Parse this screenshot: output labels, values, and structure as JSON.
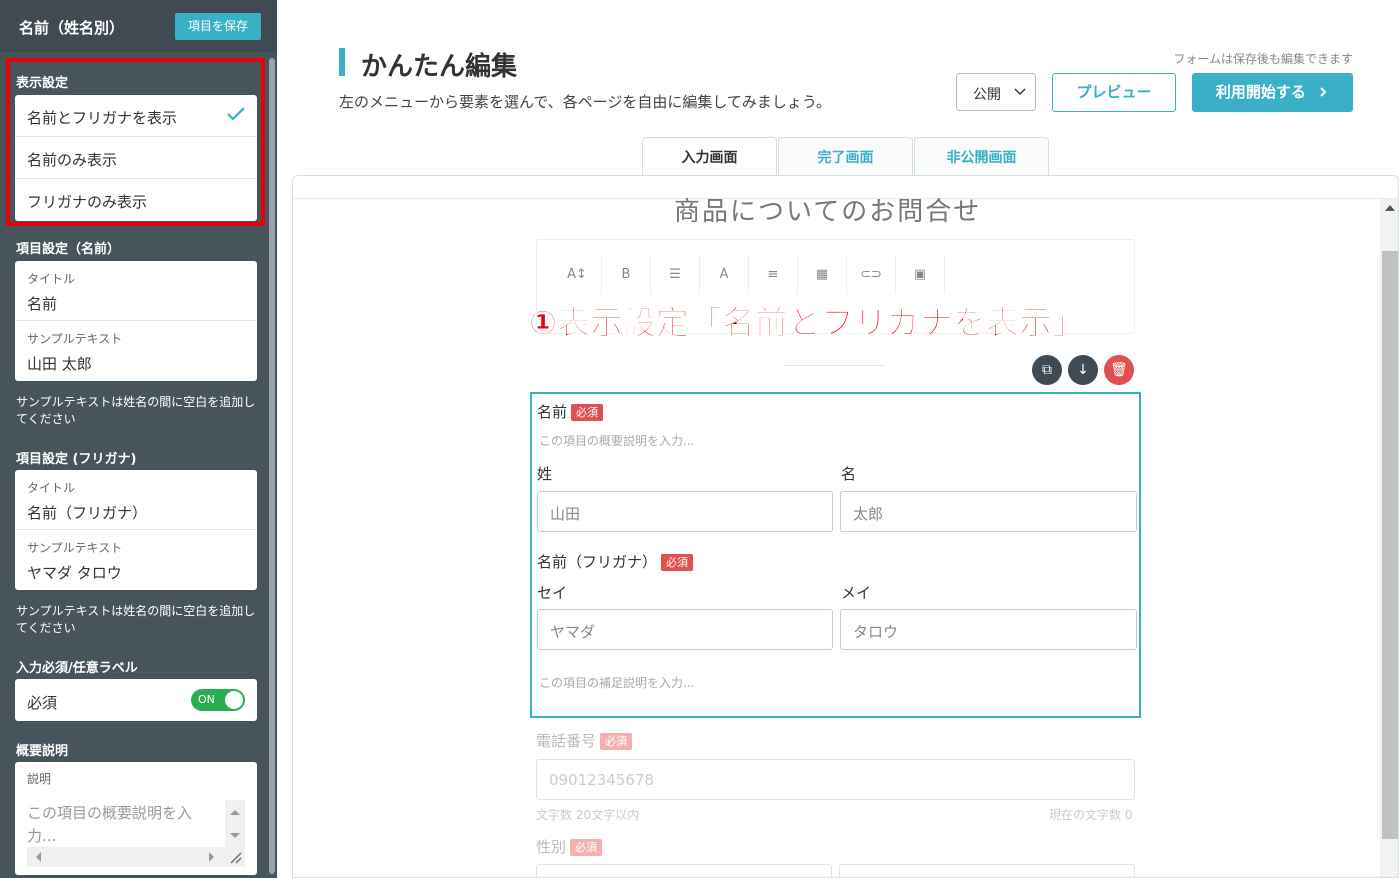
{
  "sidebar": {
    "title": "名前（姓名別）",
    "save_button": "項目を保存",
    "display_settings": {
      "label": "表示設定",
      "options": [
        "名前とフリガナを表示",
        "名前のみ表示",
        "フリガナのみ表示"
      ],
      "selected_index": 0
    },
    "name_settings": {
      "label": "項目設定（名前）",
      "title_label": "タイトル",
      "title_value": "名前",
      "sample_label": "サンプルテキスト",
      "sample_value": "山田 太郎",
      "note": "サンプルテキストは姓名の間に空白を追加してください"
    },
    "kana_settings": {
      "label": "項目設定 (フリガナ)",
      "title_label": "タイトル",
      "title_value": "名前（フリガナ）",
      "sample_label": "サンプルテキスト",
      "sample_value": "ヤマダ タロウ",
      "note": "サンプルテキストは姓名の間に空白を追加してください"
    },
    "required_label": {
      "label": "入力必須/任意ラベル",
      "value": "必須",
      "toggle": "ON",
      "toggle_on": true
    },
    "description": {
      "label": "概要説明",
      "field_label": "説明",
      "placeholder": "この項目の概要説明を入力..."
    }
  },
  "header": {
    "title": "かんたん編集",
    "subtitle": "左のメニューから要素を選んで、各ページを自由に編集してみましょう。",
    "hint": "フォームは保存後も編集できます",
    "public_select": "公開",
    "preview_button": "プレビュー",
    "start_button": "利用開始する"
  },
  "tabs": [
    {
      "label": "入力画面",
      "active": true
    },
    {
      "label": "完了画面",
      "active": false
    },
    {
      "label": "非公開画面",
      "active": false
    }
  ],
  "form": {
    "title": "商品についてのお問合せ",
    "toolbar_icons": [
      "font-size-icon",
      "bold-icon",
      "list-icon",
      "text-color-icon",
      "align-icon",
      "table-icon",
      "link-icon",
      "image-icon"
    ],
    "toolbar_glyphs": [
      "A↕",
      "B",
      "☰",
      "A",
      "≡",
      "▦",
      "⊂⊃",
      "▣"
    ],
    "annotation": "①表示設定「名前とフリガナを表示」",
    "name_block": {
      "label": "名前",
      "required": "必須",
      "desc_placeholder": "この項目の概要説明を入力...",
      "sei_label": "姓",
      "mei_label": "名",
      "sei_placeholder": "山田",
      "mei_placeholder": "太郎",
      "kana_label": "名前（フリガナ）",
      "kana_required": "必須",
      "sei_kana_label": "セイ",
      "mei_kana_label": "メイ",
      "sei_kana_placeholder": "ヤマダ",
      "mei_kana_placeholder": "タロウ",
      "supp_placeholder": "この項目の補足説明を入力..."
    },
    "phone": {
      "label": "電話番号",
      "required": "必須",
      "placeholder": "09012345678",
      "limit": "文字数 20文字以内",
      "count": "現在の文字数 0"
    },
    "gender": {
      "label": "性別",
      "required": "必須"
    }
  },
  "colors": {
    "accent": "#3ab0c6",
    "sidebar": "#48545c",
    "annotation": "#e8000b",
    "required": "#e05050",
    "toggle": "#2aae52"
  }
}
